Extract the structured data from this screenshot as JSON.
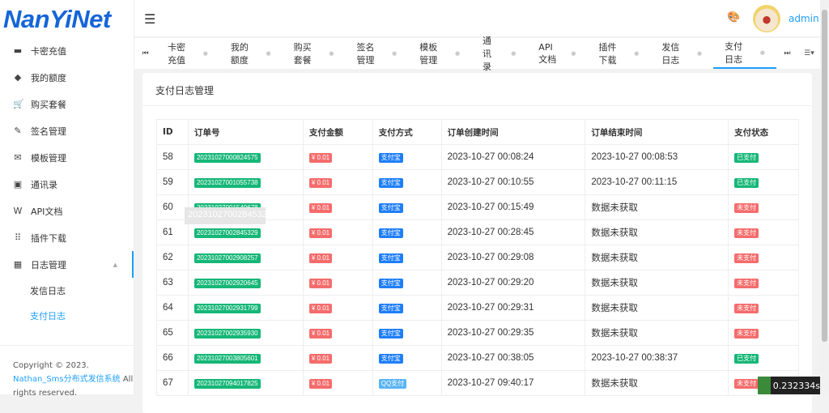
{
  "logo": "NanYiNet",
  "sidebar": {
    "items": [
      {
        "label": "卡密充值",
        "icon": "card-icon",
        "g": "▬"
      },
      {
        "label": "我的额度",
        "icon": "cube-icon",
        "g": "◆"
      },
      {
        "label": "购买套餐",
        "icon": "cart-icon",
        "g": "🛒"
      },
      {
        "label": "签名管理",
        "icon": "pen-icon",
        "g": "✎"
      },
      {
        "label": "模板管理",
        "icon": "mail-icon",
        "g": "✉"
      },
      {
        "label": "通讯录",
        "icon": "contact-icon",
        "g": "▣"
      },
      {
        "label": "API文档",
        "icon": "doc-icon",
        "g": "W"
      },
      {
        "label": "插件下载",
        "icon": "grid-icon",
        "g": "⠿"
      },
      {
        "label": "日志管理",
        "icon": "calendar-icon",
        "g": "▦"
      }
    ],
    "sub": [
      {
        "label": "发信日志"
      },
      {
        "label": "支付日志"
      }
    ]
  },
  "footer": {
    "copyright": "Copyright © 2023.",
    "link": "Nathan_Sms分布式发信系统",
    "rest": " All rights reserved."
  },
  "header": {
    "user": "admin"
  },
  "tabs": [
    "卡密充值",
    "我的额度",
    "购买套餐",
    "签名管理",
    "模板管理",
    "通讯录",
    "API文档",
    "插件下载",
    "发信日志",
    "支付日志"
  ],
  "card": {
    "title": "支付日志管理"
  },
  "table": {
    "headers": [
      "ID",
      "订单号",
      "支付金额",
      "支付方式",
      "订单创建时间",
      "订单结束时间",
      "支付状态"
    ],
    "rows": [
      [
        "58",
        "20231027000824575",
        "¥ 0.01",
        "支付宝",
        "2023-10-27 00:08:24",
        "2023-10-27 00:08:53",
        "已支付"
      ],
      [
        "59",
        "20231027001055738",
        "¥ 0.01",
        "支付宝",
        "2023-10-27 00:10:55",
        "2023-10-27 00:11:15",
        "已支付"
      ],
      [
        "60",
        "20231027001549678",
        "¥ 0.01",
        "支付宝",
        "2023-10-27 00:15:49",
        "数据未获取",
        "未支付"
      ],
      [
        "61",
        "20231027002845329",
        "¥ 0.01",
        "支付宝",
        "2023-10-27 00:28:45",
        "数据未获取",
        "未支付"
      ],
      [
        "62",
        "20231027002908257",
        "¥ 0.01",
        "支付宝",
        "2023-10-27 00:29:08",
        "数据未获取",
        "未支付"
      ],
      [
        "63",
        "20231027002920645",
        "¥ 0.01",
        "支付宝",
        "2023-10-27 00:29:20",
        "数据未获取",
        "未支付"
      ],
      [
        "64",
        "20231027002931799",
        "¥ 0.01",
        "支付宝",
        "2023-10-27 00:29:31",
        "数据未获取",
        "未支付"
      ],
      [
        "65",
        "20231027002935930",
        "¥ 0.01",
        "支付宝",
        "2023-10-27 00:29:35",
        "数据未获取",
        "未支付"
      ],
      [
        "66",
        "20231027003805601",
        "¥ 0.01",
        "支付宝",
        "2023-10-27 00:38:05",
        "2023-10-27 00:38:37",
        "已支付"
      ],
      [
        "67",
        "20231027094017825",
        "¥ 0.01",
        "QQ支付",
        "2023-10-27 09:40:17",
        "数据未获取",
        "未支付"
      ]
    ]
  },
  "tooltip": "20231027002845329",
  "timer": "0.232334s"
}
